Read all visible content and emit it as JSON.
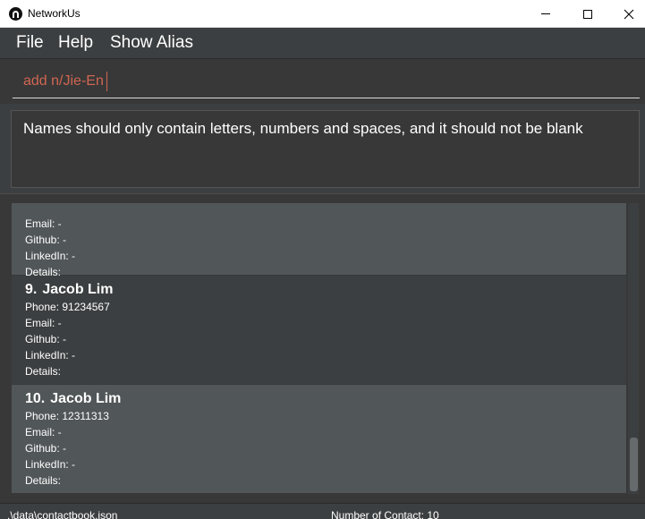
{
  "window": {
    "title": "NetworkUs",
    "app_icon": "networkus-logo-icon"
  },
  "menu": {
    "file": "File",
    "help": "Help",
    "show_alias": "Show Alias"
  },
  "command": {
    "value": "add n/Jie-En"
  },
  "result": {
    "message": "Names should only contain letters, numbers and spaces, and it should not be blank"
  },
  "contacts": [
    {
      "email": "Email: -",
      "github": "Github: -",
      "linkedin": "LinkedIn: -",
      "details": "Details:"
    },
    {
      "index": "9.",
      "name": "Jacob Lim",
      "phone": "Phone: 91234567",
      "email": "Email: -",
      "github": "Github: -",
      "linkedin": "LinkedIn: -",
      "details": "Details:"
    },
    {
      "index": "10.",
      "name": "Jacob Lim",
      "phone": "Phone: 12311313",
      "email": "Email: -",
      "github": "Github: -",
      "linkedin": "LinkedIn: -",
      "details": "Details:"
    }
  ],
  "status": {
    "file_path": ".\\data\\contactbook.json",
    "contact_count": "Number of Contact: 10"
  },
  "colors": {
    "background": "#3c3f41",
    "command_text": "#d06651",
    "card_highlight": "#515658"
  }
}
